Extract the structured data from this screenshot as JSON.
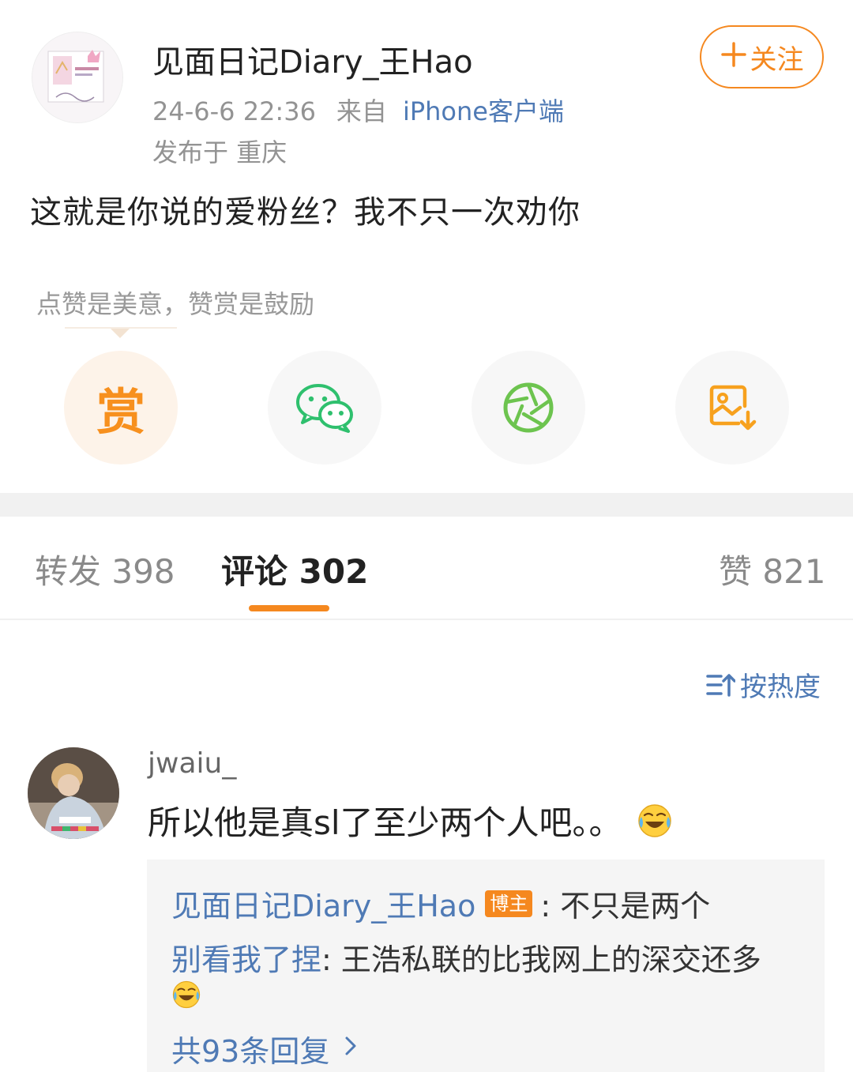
{
  "post": {
    "author_name": "见面日记Diary_王Hao",
    "timestamp": "24-6-6 22:36",
    "from_label": "来自",
    "source": "iPhone客户端",
    "location": "发布于 重庆",
    "follow_label": "关注",
    "text": "这就是你说的爱粉丝？我不只一次劝你"
  },
  "reward": {
    "hint": "点赞是美意，赞赏是鼓励",
    "reward_char": "赏",
    "actions": [
      "reward",
      "wechat-share",
      "moments-share",
      "save-image"
    ]
  },
  "tabs": {
    "repost": "转发 398",
    "comment": "评论 302",
    "like": "赞 821"
  },
  "sort": {
    "label": "按热度"
  },
  "comment": {
    "user": "jwaiu_",
    "text": "所以他是真sl了至少两个人吧。。",
    "replies": [
      {
        "name": "见面日记Diary_王Hao",
        "badge": "博主",
        "text": ": 不只是两个"
      },
      {
        "name": "别看我了捏",
        "text": ": 王浩私联的比我网上的深交还多"
      }
    ],
    "more_replies": "共93条回复"
  },
  "colors": {
    "accent_orange": "#f5881f",
    "link_blue": "#4f7ab5",
    "wechat_green": "#2fc06e",
    "moments_green": "#6dc44f"
  }
}
